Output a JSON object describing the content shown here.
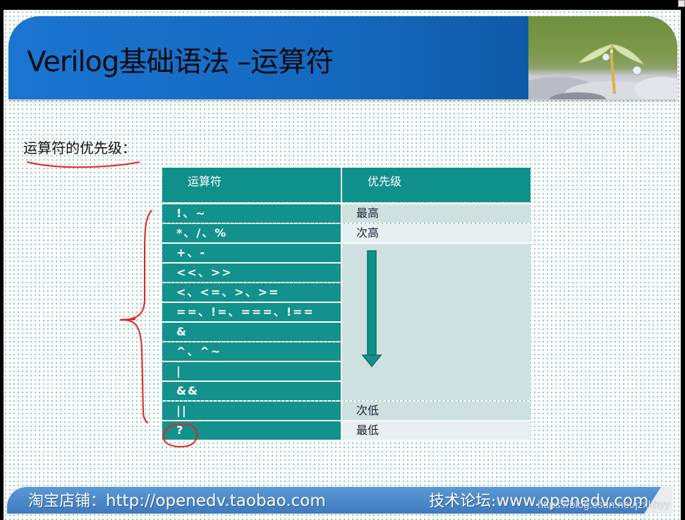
{
  "slide": {
    "title": "Verilog基础语法 –运算符",
    "subtitle": "运算符的优先级：",
    "header_photo": "seedling-photo"
  },
  "table": {
    "headers": [
      "运算符",
      "优先级"
    ],
    "rows": [
      {
        "operators": "!、~",
        "priority": "最高"
      },
      {
        "operators": "*、/、%",
        "priority": "次高"
      },
      {
        "operators": "+、-",
        "priority": ""
      },
      {
        "operators": "<<、>>",
        "priority": ""
      },
      {
        "operators": "<、<=、>、>=",
        "priority": ""
      },
      {
        "operators": "==、!=、===、!==",
        "priority": ""
      },
      {
        "operators": "&",
        "priority": ""
      },
      {
        "operators": "^、^~",
        "priority": ""
      },
      {
        "operators": "|",
        "priority": ""
      },
      {
        "operators": "&&",
        "priority": ""
      },
      {
        "operators": "||",
        "priority": "次低"
      },
      {
        "operators": "?",
        "priority": "最低"
      }
    ],
    "arrow_icon": "down-arrow-icon"
  },
  "annotations": {
    "underline": "red-underline",
    "brace": "red-brace",
    "circle": "red-circle"
  },
  "footer": {
    "shop_label": "淘宝店铺：",
    "shop_url": "http://openedv.taobao.com",
    "forum_label": "技术论坛:",
    "forum_url": "www.openedv.com"
  },
  "watermark": "https://blog.csdn.net/jzxkhyy",
  "colors": {
    "header_blue": "#1a75d1",
    "table_teal": "#13918c",
    "priority_cell": "#cfe0e0",
    "annotation_red": "#e8231c",
    "footer_blue": "#4a87c9"
  }
}
